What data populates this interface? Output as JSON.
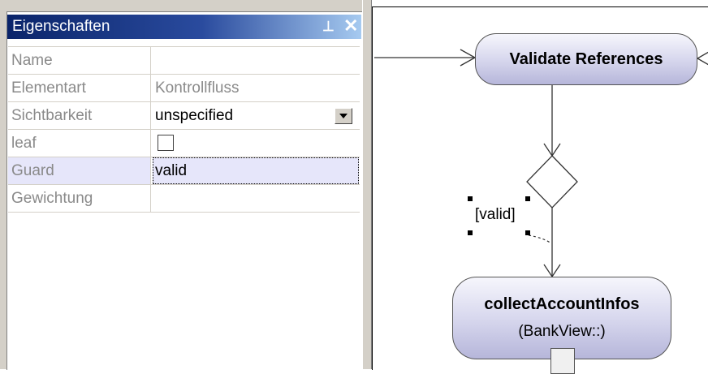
{
  "panel": {
    "title": "Eigenschaften",
    "pin_glyph": "ᵖ",
    "close_glyph": "✕",
    "rows": [
      {
        "key": "Name",
        "value": ""
      },
      {
        "key": "Elementart",
        "value": "Kontrollfluss"
      },
      {
        "key": "Sichtbarkeit",
        "value": "unspecified"
      },
      {
        "key": "leaf",
        "value": ""
      },
      {
        "key": "Guard",
        "value": "valid"
      },
      {
        "key": "Gewichtung",
        "value": ""
      }
    ]
  },
  "diagram": {
    "validate_action": "Validate References",
    "collect_action": "collectAccountInfos",
    "collect_stereotype": "(BankView::)",
    "guard_label": "[valid]"
  }
}
